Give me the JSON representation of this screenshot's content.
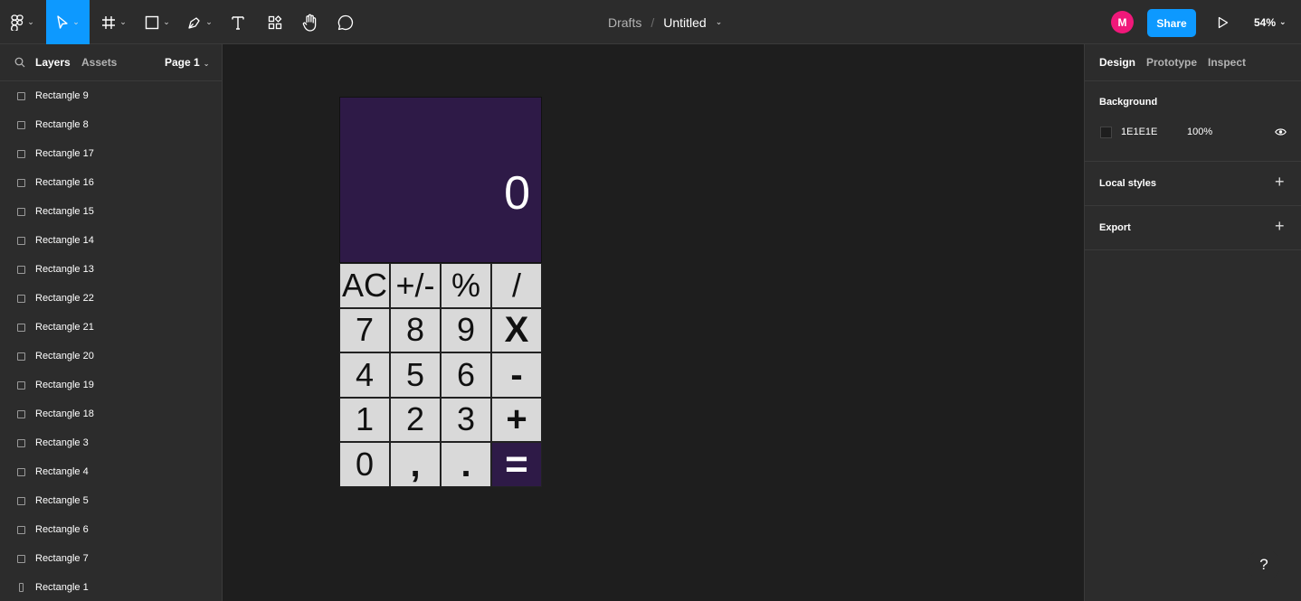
{
  "toolbar": {
    "main_menu_icon": "figma-logo-icon",
    "move_tool_icon": "move-cursor-icon",
    "frame_tool_icon": "frame-hash-icon",
    "shape_tool_icon": "rectangle-icon",
    "pen_tool_icon": "pen-icon",
    "text_tool_icon": "text-T-icon",
    "resources_icon": "resources-icon",
    "hand_tool_icon": "hand-icon",
    "comment_tool_icon": "comment-bubble-icon",
    "breadcrumb_drafts": "Drafts",
    "breadcrumb_sep": "/",
    "file_name": "Untitled",
    "avatar_initial": "M",
    "share_label": "Share",
    "present_icon": "play-icon",
    "zoom_level": "54%"
  },
  "left_panel": {
    "tab_layers": "Layers",
    "tab_assets": "Assets",
    "page_selector": "Page 1",
    "layers": [
      "Rectangle 9",
      "Rectangle 8",
      "Rectangle 17",
      "Rectangle 16",
      "Rectangle 15",
      "Rectangle 14",
      "Rectangle 13",
      "Rectangle 22",
      "Rectangle 21",
      "Rectangle 20",
      "Rectangle 19",
      "Rectangle 18",
      "Rectangle 3",
      "Rectangle 4",
      "Rectangle 5",
      "Rectangle 6",
      "Rectangle 7",
      "Rectangle 1"
    ]
  },
  "canvas": {
    "display_value": "0",
    "keys": [
      [
        "AC",
        "+/-",
        "%",
        "/"
      ],
      [
        "7",
        "8",
        "9",
        "X"
      ],
      [
        "4",
        "5",
        "6",
        "-"
      ],
      [
        "1",
        "2",
        "3",
        "+"
      ],
      [
        "0",
        ",",
        ".",
        "="
      ]
    ],
    "display_color": "#2e1a47",
    "key_color": "#d9d9d9"
  },
  "right_panel": {
    "tab_design": "Design",
    "tab_prototype": "Prototype",
    "tab_inspect": "Inspect",
    "background_title": "Background",
    "background_hex": "1E1E1E",
    "background_opacity": "100%",
    "local_styles": "Local styles",
    "export": "Export"
  },
  "help_label": "?"
}
